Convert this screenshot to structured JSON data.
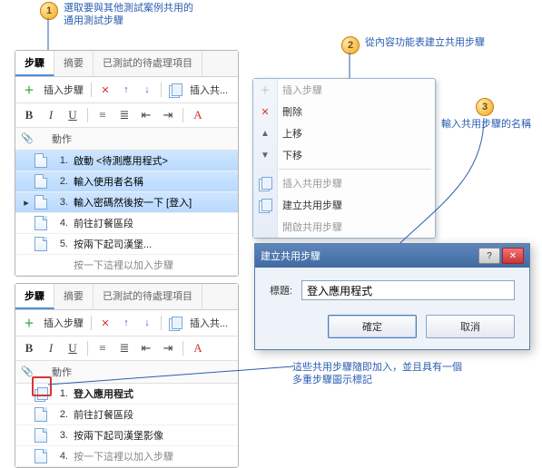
{
  "callouts": {
    "c1": {
      "num": "1",
      "text": "選取要與其他測試案例共用的\n通用測試步驟"
    },
    "c2": {
      "num": "2",
      "text": "從內容功能表建立共用步驟"
    },
    "c3": {
      "num": "3",
      "text": "輸入共用步驟的名稱"
    },
    "c4": {
      "text": "這些共用步驟隨即加入，並且具有一個\n多重步驟圖示標記"
    }
  },
  "tabs": {
    "steps": "步驟",
    "summary": "摘要",
    "pending": "已測試的待處理項目"
  },
  "toolbar": {
    "insert_step": "插入步驟",
    "insert_shared": "插入共..."
  },
  "grid": {
    "header_action": "動作"
  },
  "panel1": {
    "rows": [
      {
        "num": "1.",
        "text": "啟動 <待測應用程式>",
        "sel": true
      },
      {
        "num": "2.",
        "text": "輸入使用者名稱",
        "sel": true
      },
      {
        "num": "3.",
        "text": "輸入密碼然後按一下 [登入]",
        "sel": true
      },
      {
        "num": "4.",
        "text": "前往訂餐區段",
        "sel": false
      },
      {
        "num": "5.",
        "text": "按兩下起司漢堡...",
        "sel": false
      },
      {
        "num": "",
        "text": "按一下這裡以加入步驟",
        "sel": false
      }
    ]
  },
  "panel2": {
    "rows": [
      {
        "num": "1.",
        "text": "登入應用程式",
        "multi": true,
        "bold": true
      },
      {
        "num": "2.",
        "text": "前往訂餐區段"
      },
      {
        "num": "3.",
        "text": "按兩下起司漢堡影像"
      },
      {
        "num": "4.",
        "text": "按一下這裡以加入步驟"
      }
    ]
  },
  "menu": {
    "insert_step": "插入步驟",
    "delete": "刪除",
    "move_up": "上移",
    "move_down": "下移",
    "insert_shared": "插入共用步驟",
    "create_shared": "建立共用步驟",
    "open_shared": "開啟共用步驟"
  },
  "dialog": {
    "title": "建立共用步驟",
    "label": "標題:",
    "value": "登入應用程式",
    "ok": "確定",
    "cancel": "取消",
    "help": "?"
  }
}
